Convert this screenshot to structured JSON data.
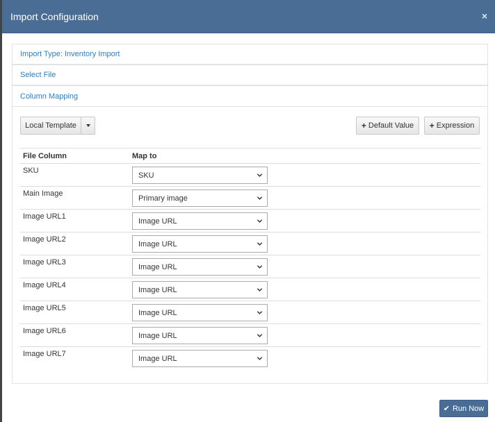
{
  "modal": {
    "title": "Import Configuration",
    "close_glyph": "×"
  },
  "accordion": {
    "import_type": "Import Type: Inventory Import",
    "select_file": "Select File",
    "column_mapping": "Column Mapping"
  },
  "toolbar": {
    "local_template": "Local Template",
    "default_value": "Default Value",
    "expression": "Expression",
    "plus_glyph": "+"
  },
  "table": {
    "headers": [
      "File Column",
      "Map to"
    ],
    "rows": [
      {
        "column": "SKU",
        "map": "SKU"
      },
      {
        "column": "Main Image",
        "map": "Primary image"
      },
      {
        "column": "Image URL1",
        "map": "Image URL"
      },
      {
        "column": "Image URL2",
        "map": "Image URL"
      },
      {
        "column": "Image URL3",
        "map": "Image URL"
      },
      {
        "column": "Image URL4",
        "map": "Image URL"
      },
      {
        "column": "Image URL5",
        "map": "Image URL"
      },
      {
        "column": "Image URL6",
        "map": "Image URL"
      },
      {
        "column": "Image URL7",
        "map": "Image URL"
      }
    ]
  },
  "footer": {
    "run_now": "Run Now",
    "check_glyph": "✔"
  },
  "colors": {
    "header_bg": "#4a6d95",
    "link": "#2f7bb8"
  }
}
